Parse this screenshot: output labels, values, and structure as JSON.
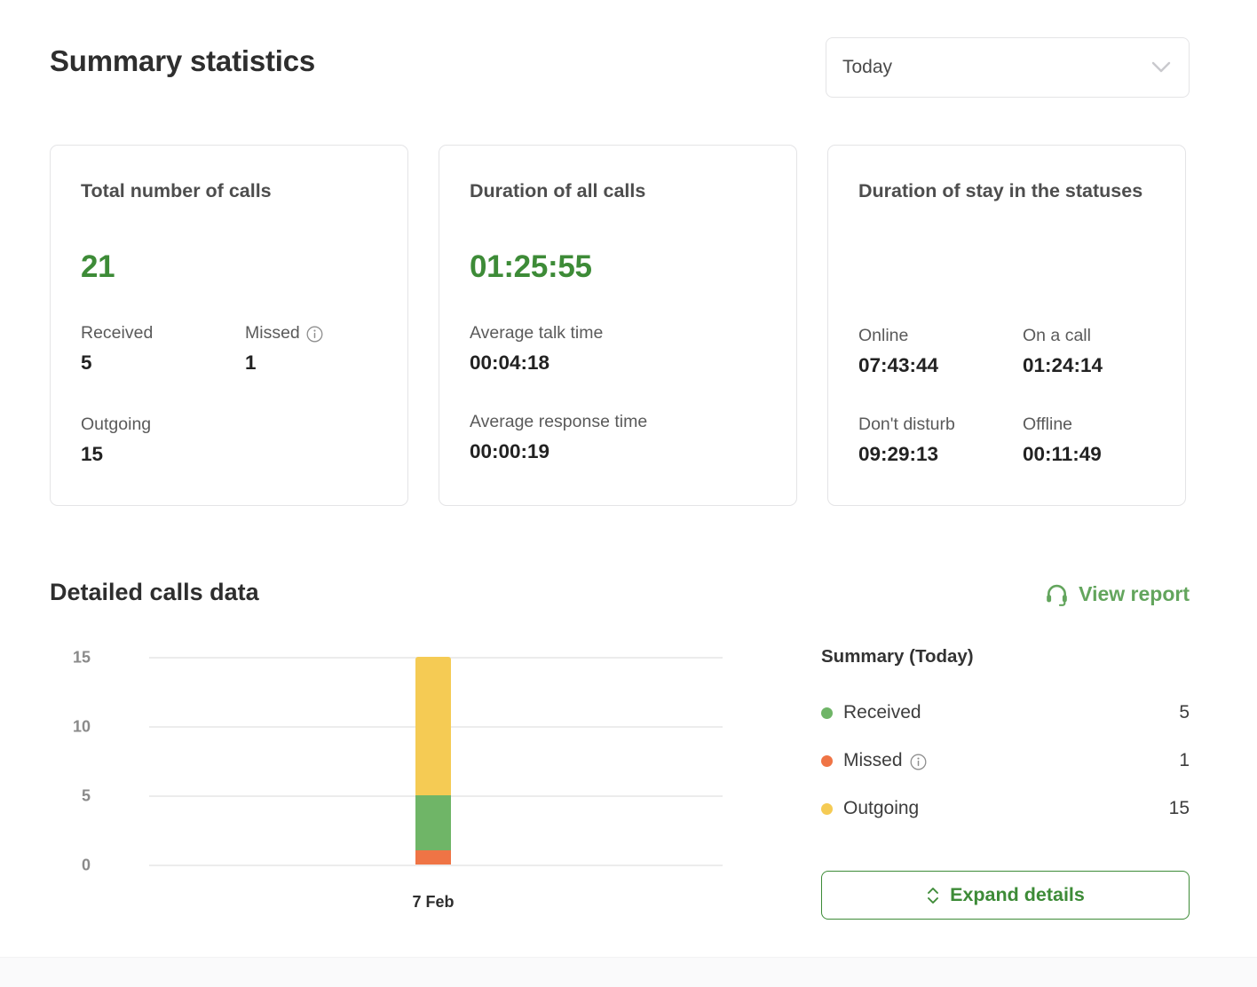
{
  "header": {
    "title": "Summary statistics",
    "period_select": {
      "value": "Today",
      "icon": "chevron-down-icon"
    }
  },
  "cards": [
    {
      "title": "Total number of calls",
      "hero": "21",
      "metrics": [
        {
          "label": "Received",
          "value": "5"
        },
        {
          "label": "Missed",
          "value": "1",
          "icon": "info-icon"
        },
        {
          "label": "Outgoing",
          "value": "15"
        }
      ]
    },
    {
      "title": "Duration of all calls",
      "hero": "01:25:55",
      "metrics": [
        {
          "label": "Average talk time",
          "value": "00:04:18"
        },
        {
          "label": "Average response time",
          "value": "00:00:19"
        }
      ]
    },
    {
      "title": "Duration of stay in the statuses",
      "hero": "",
      "metrics": [
        {
          "label": "Online",
          "value": "07:43:44"
        },
        {
          "label": "On a call",
          "value": "01:24:14"
        },
        {
          "label": "Don't disturb",
          "value": "09:29:13"
        },
        {
          "label": "Offline",
          "value": "00:11:49"
        }
      ]
    }
  ],
  "detailed": {
    "title": "Detailed calls data",
    "view_report": {
      "label": "View report",
      "icon": "headset-icon"
    },
    "summary": {
      "title": "Summary (Today)",
      "legend": [
        {
          "label": "Received",
          "value": "5",
          "color": "#6fb567"
        },
        {
          "label": "Missed",
          "value": "1",
          "color": "#ef7445",
          "icon": "info-icon"
        },
        {
          "label": "Outgoing",
          "value": "15",
          "color": "#f5cb54"
        }
      ],
      "expand_button": {
        "label": "Expand details",
        "icon": "chevron-up-down-icon"
      }
    }
  },
  "chart_data": {
    "type": "bar",
    "stacked": true,
    "title": "Detailed calls data",
    "xlabel": "",
    "ylabel": "",
    "categories": [
      "7 Feb"
    ],
    "series": [
      {
        "name": "Missed",
        "values": [
          1
        ],
        "color": "#ef7445"
      },
      {
        "name": "Received",
        "values": [
          4
        ],
        "color": "#6fb567"
      },
      {
        "name": "Outgoing",
        "values": [
          10
        ],
        "color": "#f5cb54"
      }
    ],
    "totals": [
      15
    ],
    "ylim": [
      0,
      15
    ],
    "yticks": [
      0,
      5,
      10,
      15
    ],
    "grid": true,
    "legend_position": "right",
    "note": "Segment heights are stacked: Missed 0-1, Received 1-5, Outgoing 5-15"
  },
  "colors": {
    "accent_green": "#3d8b37",
    "link_green": "#63a55d",
    "received": "#6fb567",
    "missed": "#ef7445",
    "outgoing": "#f5cb54",
    "border": "#e4e4e6",
    "gridline": "#ececec"
  }
}
